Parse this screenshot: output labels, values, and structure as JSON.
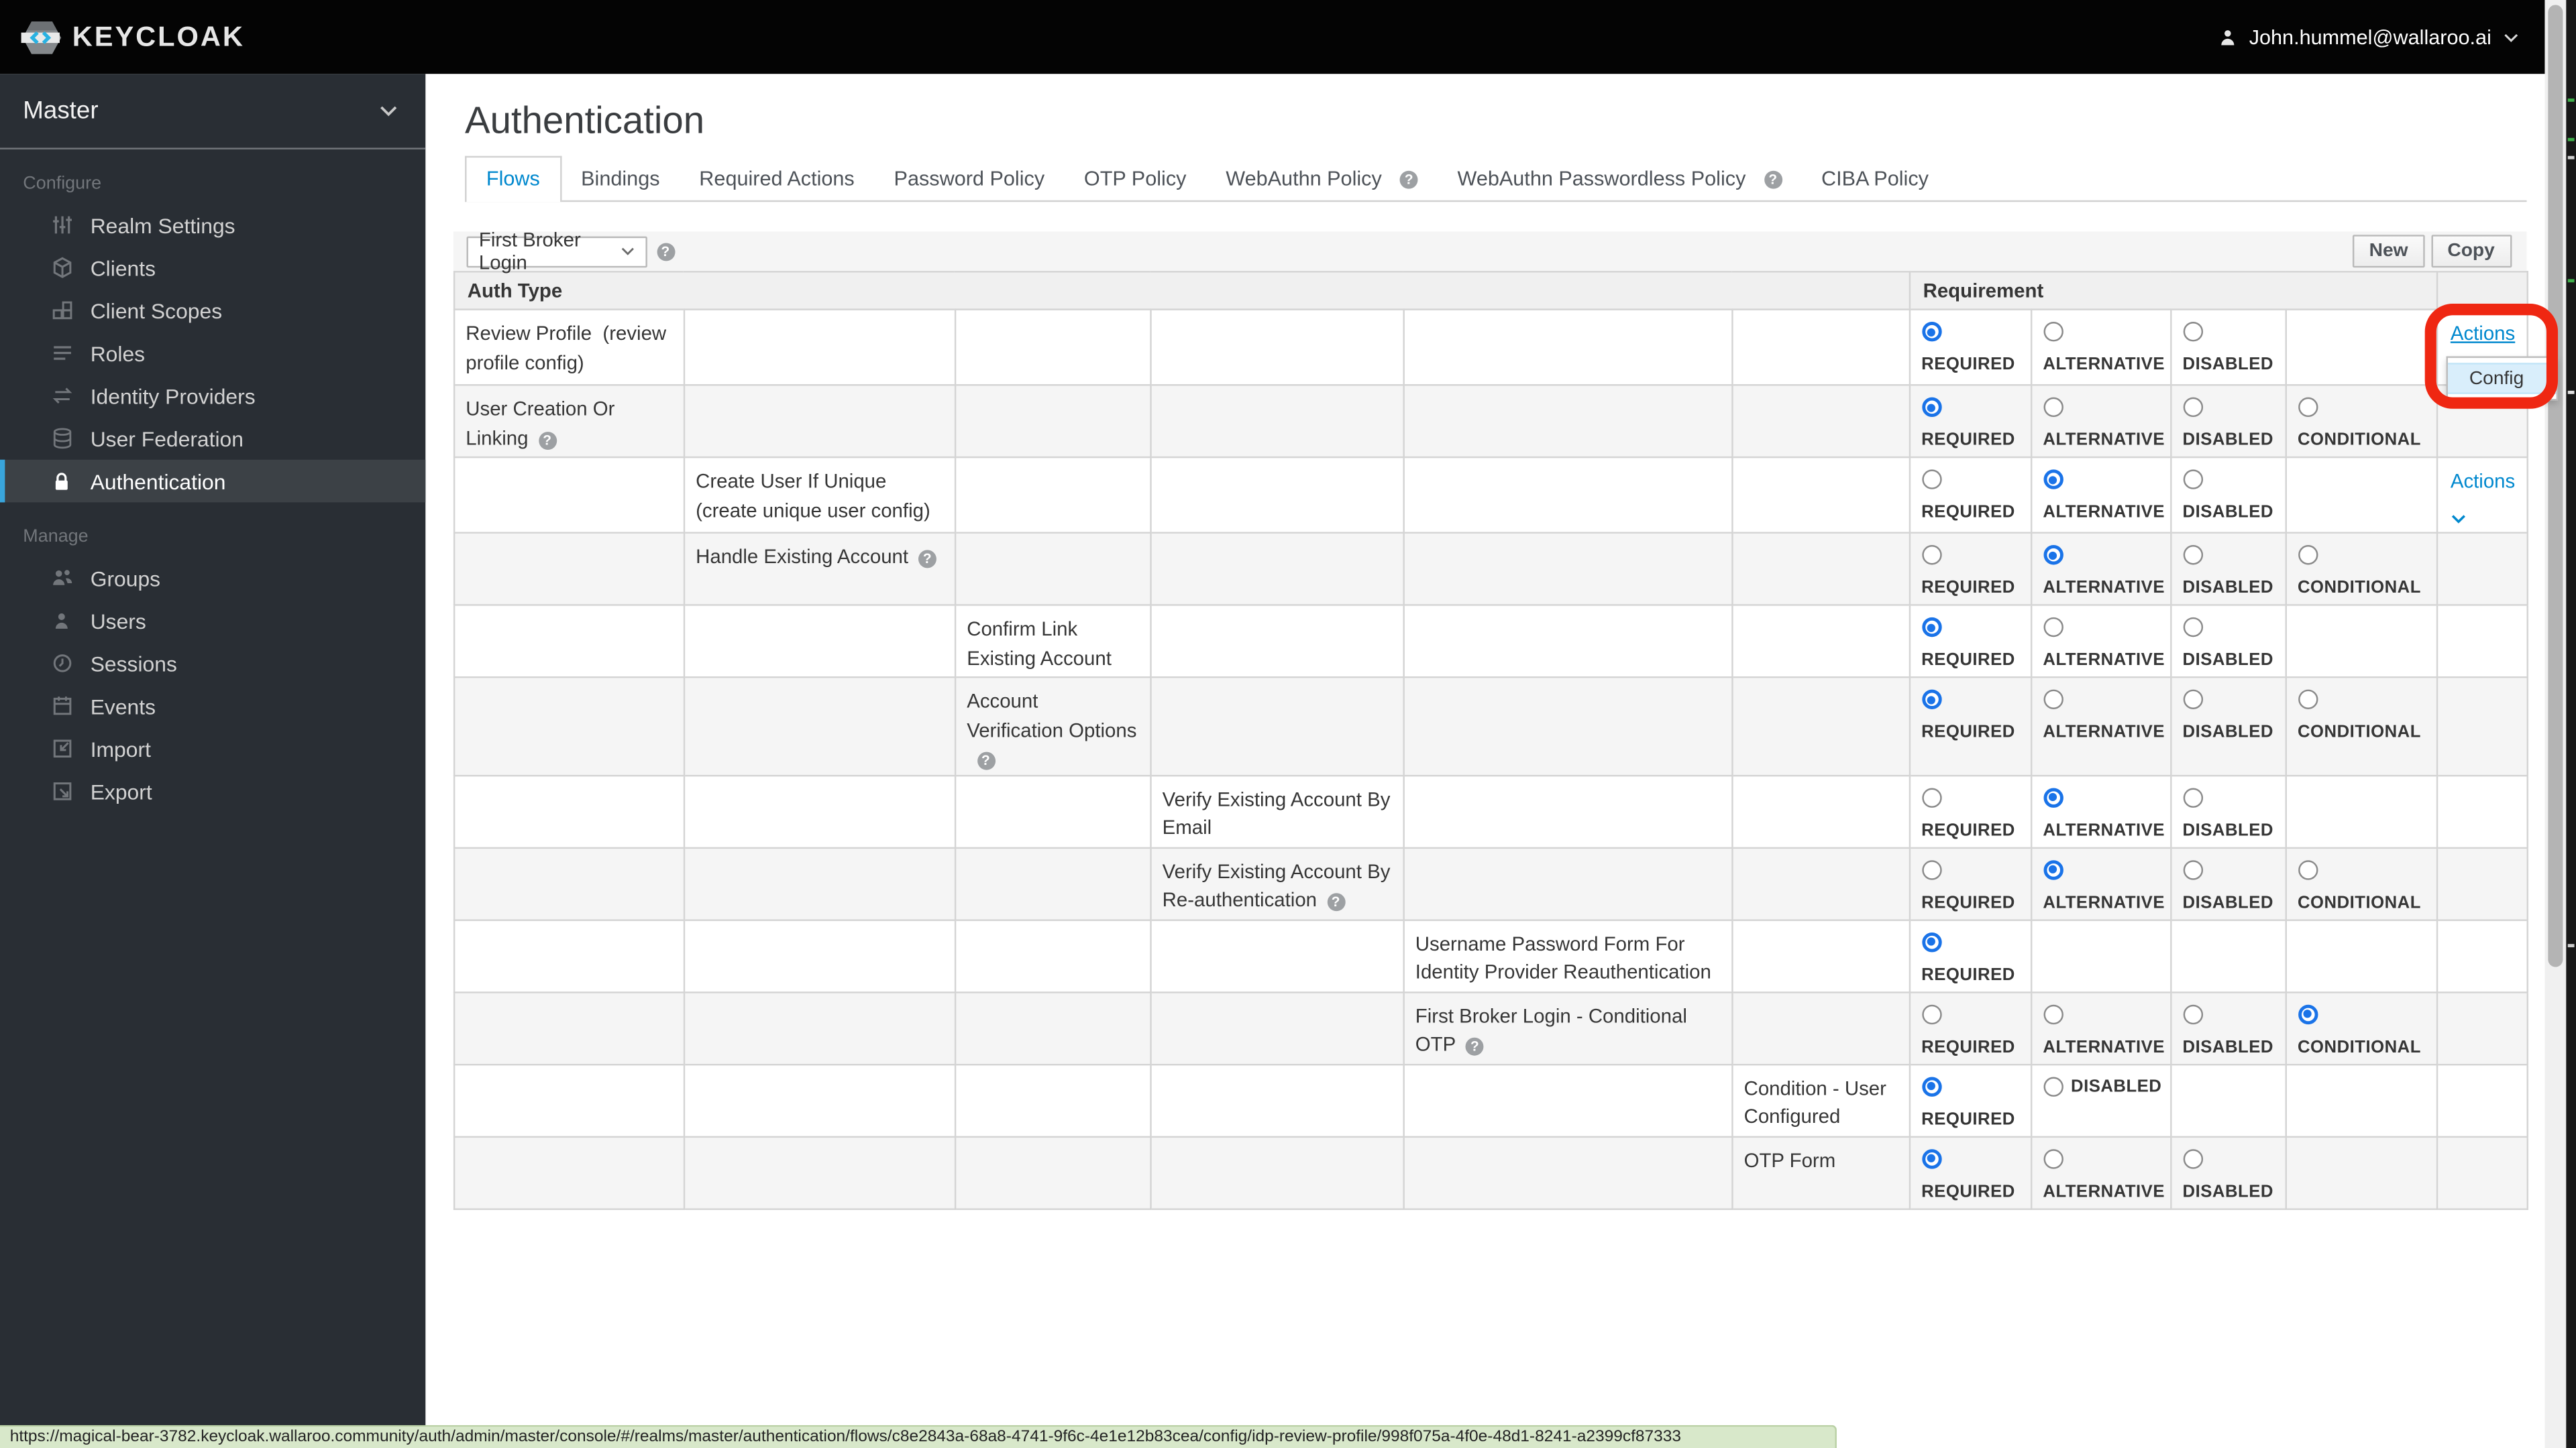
{
  "topbar": {
    "brand": "KEYCLOAK",
    "user": "John.hummel@wallaroo.ai"
  },
  "sidebar": {
    "realm": "Master",
    "configure_label": "Configure",
    "configure_items": [
      "Realm Settings",
      "Clients",
      "Client Scopes",
      "Roles",
      "Identity Providers",
      "User Federation",
      "Authentication"
    ],
    "manage_label": "Manage",
    "manage_items": [
      "Groups",
      "Users",
      "Sessions",
      "Events",
      "Import",
      "Export"
    ]
  },
  "main": {
    "title": "Authentication",
    "tabs": [
      "Flows",
      "Bindings",
      "Required Actions",
      "Password Policy",
      "OTP Policy",
      "WebAuthn Policy",
      "WebAuthn Passwordless Policy",
      "CIBA Policy"
    ],
    "toolbar": {
      "flow_select_value": "First Broker Login",
      "new_label": "New",
      "copy_label": "Copy"
    },
    "table": {
      "auth_type_header": "Auth Type",
      "requirement_header": "Requirement",
      "requirement_labels": {
        "required": "REQUIRED",
        "alternative": "ALTERNATIVE",
        "disabled": "DISABLED",
        "conditional": "CONDITIONAL"
      },
      "actions_label": "Actions",
      "config_label": "Config",
      "rows": [
        {
          "label": "Review Profile  (review profile config)",
          "indent": 1,
          "required": "sel",
          "alternative": "un",
          "disabled": "un",
          "actions": "open"
        },
        {
          "label": "User Creation Or Linking",
          "help": true,
          "indent": 1,
          "required": "sel",
          "alternative": "un",
          "disabled": "un",
          "conditional": "un"
        },
        {
          "label": "Create User If Unique  (create unique user config)",
          "indent": 2,
          "required": "un",
          "alternative": "sel",
          "disabled": "un",
          "actions": "link"
        },
        {
          "label": "Handle Existing Account",
          "help": true,
          "indent": 2,
          "required": "un",
          "alternative": "sel",
          "disabled": "un",
          "conditional": "un"
        },
        {
          "label": "Confirm Link Existing Account",
          "indent": 3,
          "required": "sel",
          "alternative": "un",
          "disabled": "un"
        },
        {
          "label": "Account Verification Options",
          "help": true,
          "indent": 3,
          "required": "sel",
          "alternative": "un",
          "disabled": "un",
          "conditional": "un"
        },
        {
          "label": "Verify Existing Account By Email",
          "indent": 4,
          "required": "un",
          "alternative": "sel",
          "disabled": "un"
        },
        {
          "label": "Verify Existing Account By Re-authentication",
          "help": true,
          "indent": 4,
          "required": "un",
          "alternative": "sel",
          "disabled": "un",
          "conditional": "un"
        },
        {
          "label": "Username Password Form For Identity Provider Reauthentication",
          "indent": 5,
          "required": "sel"
        },
        {
          "label": "First Broker Login - Conditional OTP",
          "help": true,
          "indent": 5,
          "required": "un",
          "alternative": "un",
          "disabled": "un",
          "conditional": "sel"
        },
        {
          "label": "Condition - User Configured",
          "indent": 6,
          "required": "sel",
          "disabled_inline": "un"
        },
        {
          "label": "OTP Form",
          "indent": 6,
          "required": "sel",
          "alternative": "un",
          "disabled": "un"
        }
      ]
    }
  },
  "statusbar": {
    "url": "https://magical-bear-3782.keycloak.wallaroo.community/auth/admin/master/console/#/realms/master/authentication/flows/c8e2843a-68a8-4741-9f6c-4e1e12b83cea/config/idp-review-profile/998f075a-4f0e-48d1-8241-a2399cf87333"
  },
  "colors": {
    "accent_blue": "#0088ce",
    "radio_blue": "#1a73e8",
    "active_nav_border": "#39a5dc",
    "annotation_red": "#ef2712",
    "menu_highlight": "#d9eefb",
    "status_green": "#d8e8ca",
    "sidebar_bg": "#292e34",
    "topbar_bg": "#040404"
  }
}
